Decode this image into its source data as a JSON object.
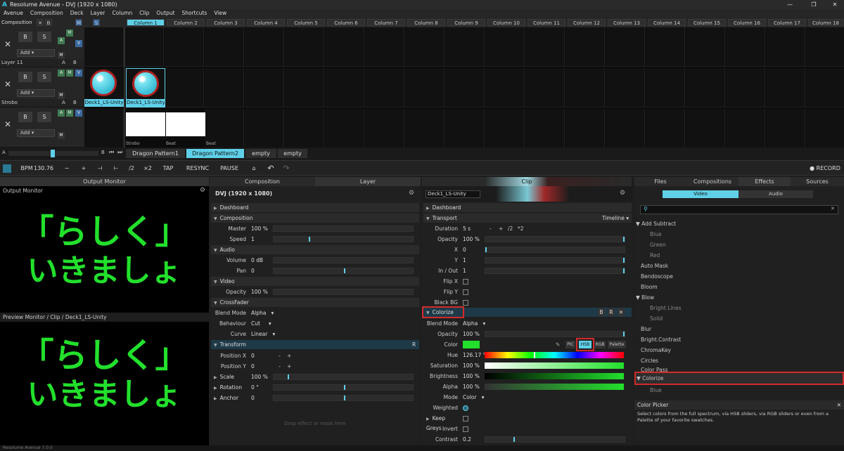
{
  "window": {
    "title": "Resolume Avenue - DVJ (1920 x 1080)",
    "logo": "A",
    "min": "—",
    "max": "❐",
    "close": "✕"
  },
  "menu": [
    "Avenue",
    "Composition",
    "Deck",
    "Layer",
    "Column",
    "Clip",
    "Output",
    "Shortcuts",
    "View"
  ],
  "header": {
    "composition": "Composition",
    "x": "✕",
    "b": "B",
    "m": "M",
    "s": "S",
    "columns": [
      "Column 1",
      "Column 2",
      "Column 3",
      "Column 4",
      "Column 5",
      "Column 6",
      "Column 7",
      "Column 8",
      "Column 9",
      "Column 10",
      "Column 11",
      "Column 12",
      "Column 13",
      "Column 14",
      "Column 15",
      "Column 16",
      "Column 17",
      "Column 18"
    ]
  },
  "layers": [
    {
      "name": "Layer 11",
      "add": "Add",
      "b": "B",
      "s": "S",
      "a": "A",
      "bb": "B",
      "m": "M",
      "v": "V"
    },
    {
      "name": "Strobo",
      "add": "Add",
      "b": "B",
      "s": "S",
      "a": "A",
      "bb": "B",
      "m": "M",
      "v": "V"
    },
    {
      "name": "",
      "add": "Add",
      "b": "B",
      "s": "S",
      "a": "A",
      "bb": "B",
      "m": "M",
      "v": "V"
    }
  ],
  "clips": {
    "deck_label": "Deck1_LS-Unity",
    "bottom_labels": [
      "Strobo",
      "Beat",
      "Beat"
    ]
  },
  "decks": {
    "a": "A",
    "b": "B",
    "prev": "⏮",
    "next": "⏭",
    "tabs": [
      "Dragon Pattern1",
      "Dragon Pattern2",
      "empty",
      "empty"
    ]
  },
  "transport": {
    "bpm_label": "BPM",
    "bpm": "130.76",
    "minus": "−",
    "plus": "+",
    "nudge_l": "⊣",
    "nudge_r": "⊢",
    "half": "/2",
    "double": "×2",
    "tap": "TAP",
    "resync": "RESYNC",
    "pause": "PAUSE",
    "record": "RECORD"
  },
  "output": {
    "tab": "Output Monitor",
    "title": "Output Monitor",
    "text1": "「らしく」",
    "text2": "いきましょ"
  },
  "preview": {
    "title": "Preview Monitor / Clip / Deck1_LS-Unity",
    "text1": "「らしく」",
    "text2": "いきましょ"
  },
  "layer_panel": {
    "tab_comp": "Composition",
    "tab_layer": "Layer",
    "title": "DVJ (1920 x 1080)",
    "dashboard": "Dashboard",
    "composition": "Composition",
    "master": "Master",
    "master_v": "100 %",
    "speed": "Speed",
    "speed_v": "1",
    "audio": "Audio",
    "volume": "Volume",
    "volume_v": "0 dB",
    "pan": "Pan",
    "pan_v": "0",
    "video": "Video",
    "opacity": "Opacity",
    "opacity_v": "100 %",
    "crossfader": "CrossFader",
    "blend": "Blend Mode",
    "blend_v": "Alpha",
    "behaviour": "Behaviour",
    "behaviour_v": "Cut",
    "curve": "Curve",
    "curve_v": "Linear",
    "transform": "Transform",
    "r": "R",
    "posx": "Position X",
    "posx_v": "0",
    "posy": "Position Y",
    "posy_v": "0",
    "scale": "Scale",
    "scale_v": "100 %",
    "rotation": "Rotation",
    "rotation_v": "0 °",
    "anchor": "Anchor",
    "anchor_v": "0",
    "drop": "Drop effect or mask here"
  },
  "clip_panel": {
    "tab": "Clip",
    "name": "Deck1_LS-Unity",
    "dashboard": "Dashboard",
    "transport": "Transport",
    "timeline": "Timeline",
    "duration": "Duration",
    "duration_v": "5 s",
    "dminus": "-",
    "dplus": "+",
    "dhalf": "/2",
    "ddouble": "*2",
    "opacity": "Opacity",
    "opacity_v": "100 %",
    "x": "X",
    "x_v": "0",
    "y": "Y",
    "y_v": "1",
    "inout": "In / Out",
    "inout_v": "1",
    "flipx": "Flip X",
    "flipy": "Flip Y",
    "blackbg": "Black BG",
    "colorize": "Colorize",
    "cb": "B",
    "cr": "R",
    "cx": "✕",
    "blend": "Blend Mode",
    "blend_v": "Alpha",
    "c_opacity": "Opacity",
    "c_opacity_v": "100 %",
    "color": "Color",
    "pic": "PIC",
    "hsb": "HSB",
    "rgb": "RGB",
    "palette": "Palette",
    "hue": "Hue",
    "hue_v": "126.17 °",
    "sat": "Saturation",
    "sat_v": "100 %",
    "bri": "Brightness",
    "bri_v": "100 %",
    "alpha": "Alpha",
    "alpha_v": "100 %",
    "mode": "Mode",
    "mode_v": "Color",
    "weighted": "Weighted",
    "keepgreys": "Keep Greys",
    "invert": "Invert",
    "contrast": "Contrast",
    "contrast_v": "0.2"
  },
  "browser": {
    "tabs": [
      "Files",
      "Compositions",
      "Effects",
      "Sources"
    ],
    "video": "Video",
    "audio": "Audio",
    "items": [
      {
        "t": "Add Subtract",
        "kind": "group"
      },
      {
        "t": "Blue",
        "kind": "sub"
      },
      {
        "t": "Green",
        "kind": "sub"
      },
      {
        "t": "Red",
        "kind": "sub"
      },
      {
        "t": "Auto Mask",
        "kind": "item"
      },
      {
        "t": "Bendoscope",
        "kind": "item"
      },
      {
        "t": "Bloom",
        "kind": "item"
      },
      {
        "t": "Blow",
        "kind": "group"
      },
      {
        "t": "Bright Lines",
        "kind": "sub"
      },
      {
        "t": "Solid",
        "kind": "sub"
      },
      {
        "t": "Blur",
        "kind": "item"
      },
      {
        "t": "Bright.Contrast",
        "kind": "item"
      },
      {
        "t": "ChromaKey",
        "kind": "item"
      },
      {
        "t": "Circles",
        "kind": "item"
      },
      {
        "t": "Color Pass",
        "kind": "item"
      },
      {
        "t": "Colorize",
        "kind": "group"
      },
      {
        "t": "Blue",
        "kind": "sub"
      }
    ],
    "info_title": "Color Picker",
    "info_close": "✕",
    "info_text": "Select colors from the full spectrum, via HSB sliders, via RGB sliders or even from a Palette of your favorite swatches."
  },
  "status": {
    "text": "Resolume Avenue 7.0.0"
  },
  "colors": {
    "accent": "#5fd0e8",
    "green": "#22e02c",
    "red": "#d42a2a"
  }
}
